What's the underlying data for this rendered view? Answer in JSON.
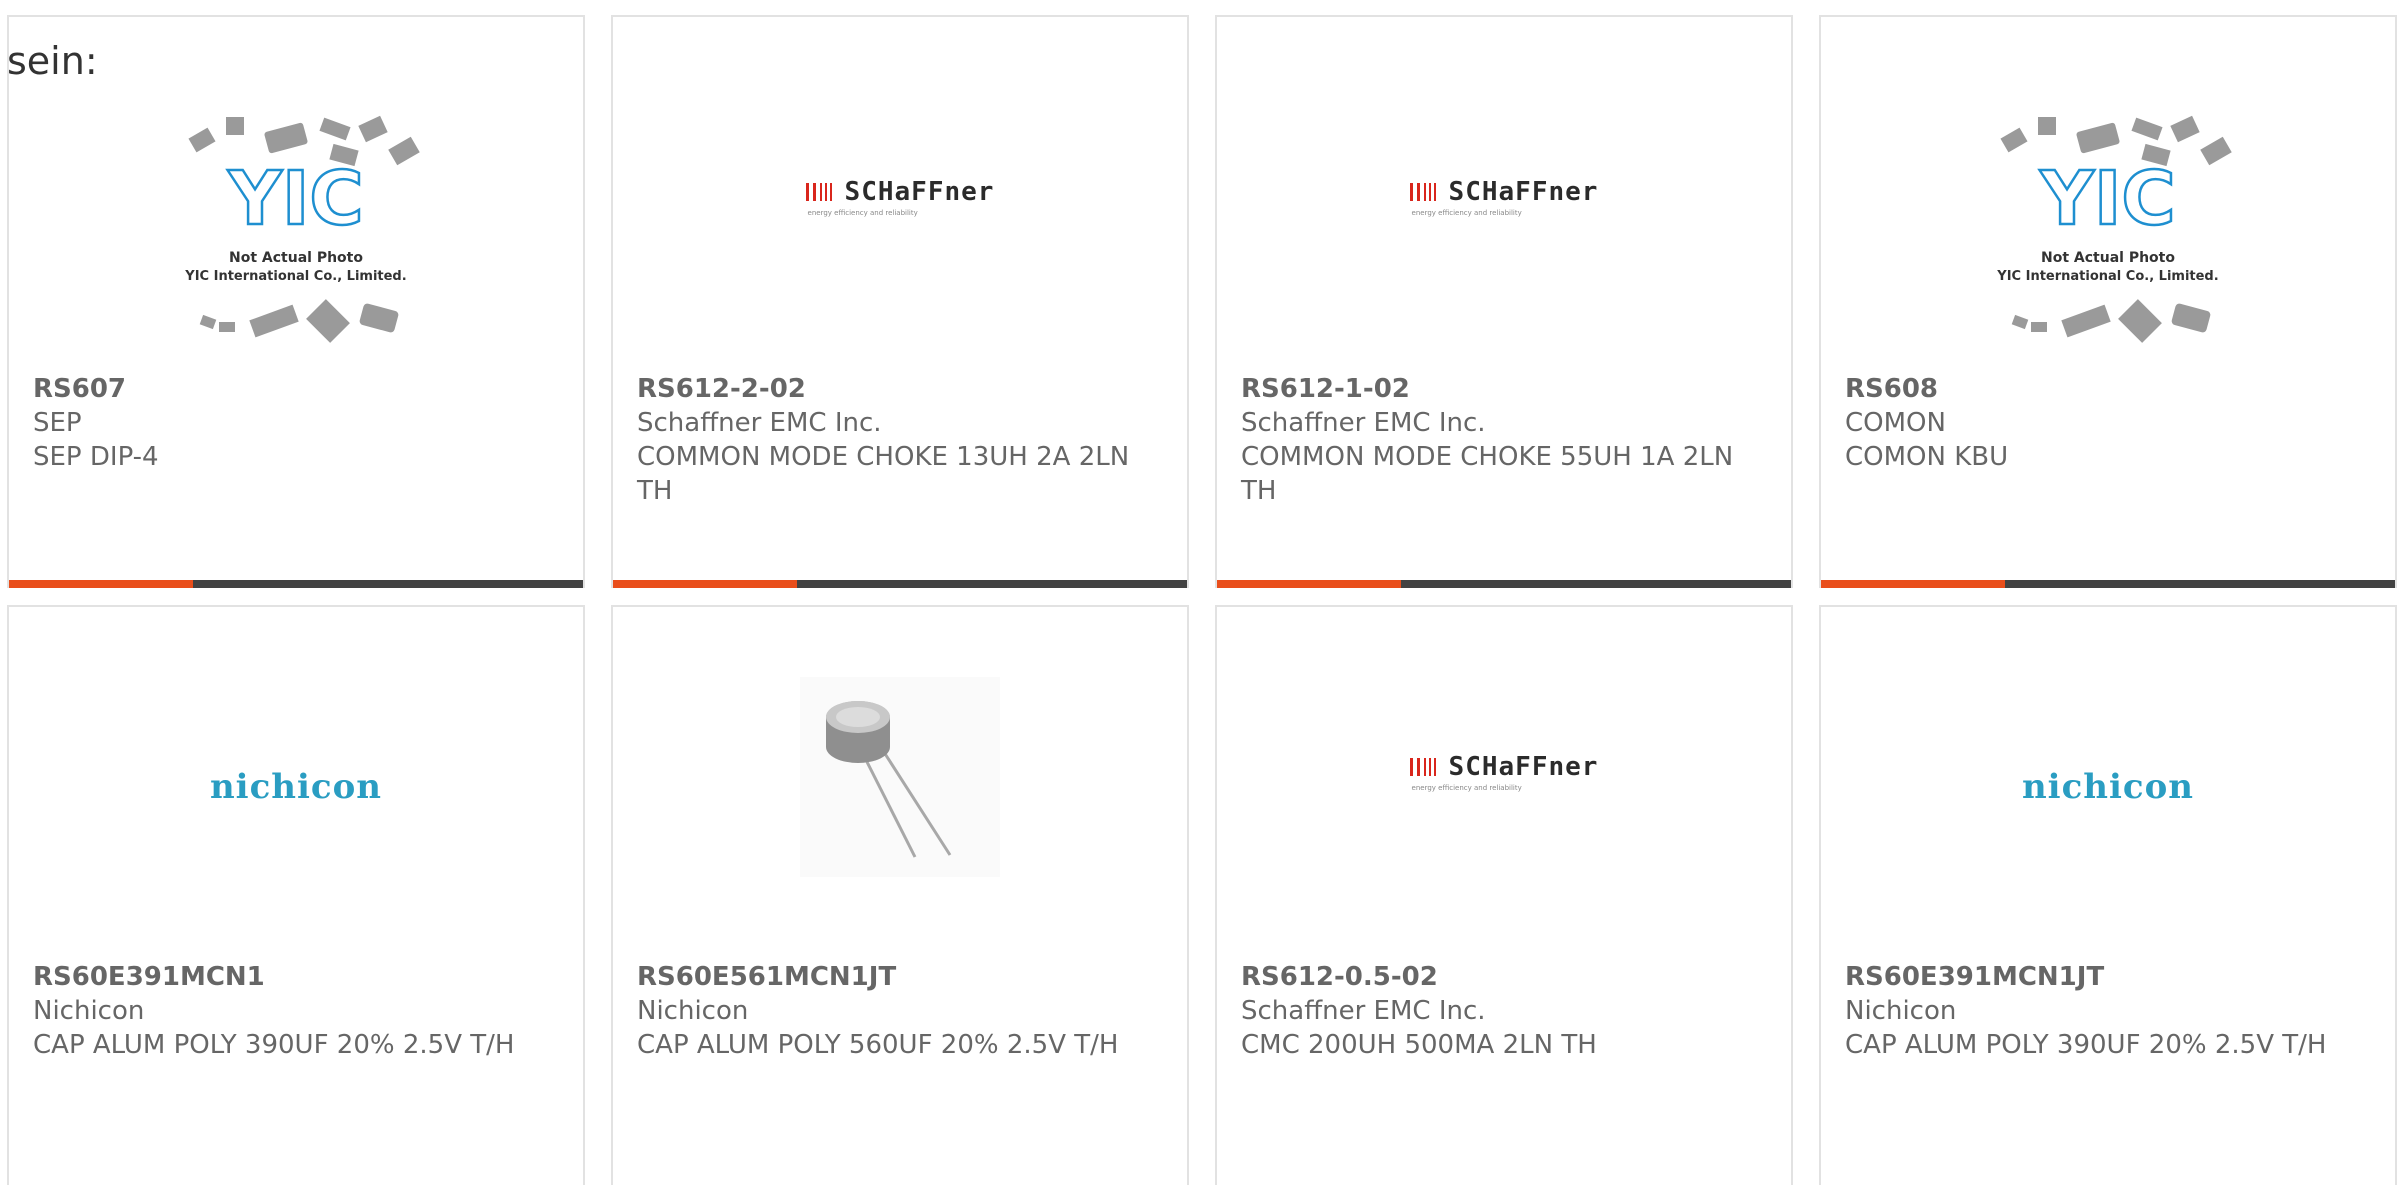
{
  "intro_text": "sein:",
  "colors": {
    "accent": "#e94e1b",
    "bar": "#424242",
    "nichicon": "#2a9dc2",
    "schaffner_red": "#d9261c",
    "yic_blue": "#1e8fd0"
  },
  "products": [
    {
      "part": "RS607",
      "manufacturer": "SEP",
      "description": "SEP DIP-4",
      "image": "yic-placeholder"
    },
    {
      "part": "RS612-2-02",
      "manufacturer": "Schaffner EMC Inc.",
      "description": "COMMON MODE CHOKE 13UH 2A 2LN TH",
      "image": "schaffner-logo"
    },
    {
      "part": "RS612-1-02",
      "manufacturer": "Schaffner EMC Inc.",
      "description": "COMMON MODE CHOKE 55UH 1A 2LN TH",
      "image": "schaffner-logo"
    },
    {
      "part": "RS608",
      "manufacturer": "COMON",
      "description": "COMON KBU",
      "image": "yic-placeholder"
    },
    {
      "part": "RS60E391MCN1",
      "manufacturer": "Nichicon",
      "description": "CAP ALUM POLY 390UF 20% 2.5V T/H",
      "image": "nichicon-logo"
    },
    {
      "part": "RS60E561MCN1JT",
      "manufacturer": "Nichicon",
      "description": "CAP ALUM POLY 560UF 20% 2.5V T/H",
      "image": "capacitor-photo"
    },
    {
      "part": "RS612-0.5-02",
      "manufacturer": "Schaffner EMC Inc.",
      "description": "CMC 200UH 500MA 2LN TH",
      "image": "schaffner-logo"
    },
    {
      "part": "RS60E391MCN1JT",
      "manufacturer": "Nichicon",
      "description": "CAP ALUM POLY 390UF 20% 2.5V T/H",
      "image": "nichicon-logo"
    }
  ],
  "logos": {
    "schaffner_word": "SCHaFFner",
    "schaffner_tagline": "energy efficiency and reliability",
    "nichicon_word": "nichicon",
    "yic_letters": "YIC",
    "yic_caption_1": "Not Actual Photo",
    "yic_caption_2": "YIC International Co., Limited."
  }
}
